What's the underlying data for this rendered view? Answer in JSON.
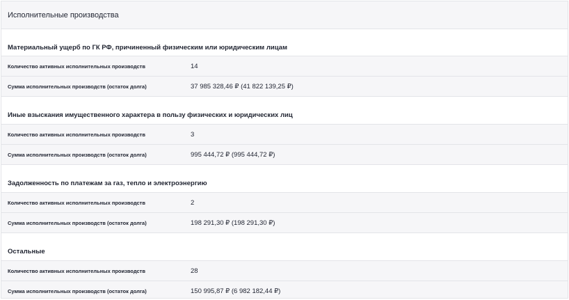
{
  "panel": {
    "title": "Исполнительные производства"
  },
  "sections": [
    {
      "title": "Материальный ущерб по ГК РФ, причиненный физическим или юридическим лицам",
      "rows": [
        {
          "label": "Количество активных исполнительных производств",
          "value": "14"
        },
        {
          "label": "Сумма исполнительных производств (остаток долга)",
          "value": "37 985 328,46 ₽ (41 822 139,25 ₽)"
        }
      ]
    },
    {
      "title": "Иные взыскания имущественного характера в пользу физических и юридических лиц",
      "rows": [
        {
          "label": "Количество активных исполнительных производств",
          "value": "3"
        },
        {
          "label": "Сумма исполнительных производств (остаток долга)",
          "value": "995 444,72 ₽ (995 444,72 ₽)"
        }
      ]
    },
    {
      "title": "Задолженность по платежам за газ, тепло и электроэнергию",
      "rows": [
        {
          "label": "Количество активных исполнительных производств",
          "value": "2"
        },
        {
          "label": "Сумма исполнительных производств (остаток долга)",
          "value": "198 291,30 ₽ (198 291,30 ₽)"
        }
      ]
    },
    {
      "title": "Остальные",
      "rows": [
        {
          "label": "Количество активных исполнительных производств",
          "value": "28"
        },
        {
          "label": "Сумма исполнительных производств (остаток долга)",
          "value": "150 995,87 ₽ (6 982 182,44 ₽)"
        }
      ]
    }
  ]
}
